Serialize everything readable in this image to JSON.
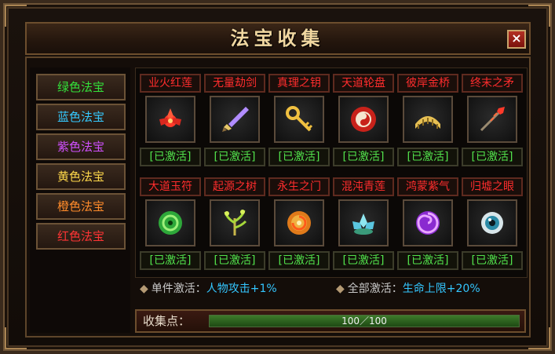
{
  "window": {
    "title": "法宝收集",
    "close_label": "×"
  },
  "sidebar": {
    "items": [
      {
        "label": "绿色法宝",
        "color": "#33e13a"
      },
      {
        "label": "蓝色法宝",
        "color": "#35c9ff"
      },
      {
        "label": "紫色法宝",
        "color": "#d050ff"
      },
      {
        "label": "黄色法宝",
        "color": "#ffd84a"
      },
      {
        "label": "橙色法宝",
        "color": "#ff8b2a"
      },
      {
        "label": "红色法宝",
        "color": "#ff3434"
      }
    ]
  },
  "treasures": {
    "row1": [
      {
        "name": "业火红莲",
        "status": "[已激活]",
        "icon": "red-lotus-icon"
      },
      {
        "name": "无量劫剑",
        "status": "[已激活]",
        "icon": "sword-icon"
      },
      {
        "name": "真理之钥",
        "status": "[已激活]",
        "icon": "key-icon"
      },
      {
        "name": "天道轮盘",
        "status": "[已激活]",
        "icon": "wheel-icon"
      },
      {
        "name": "彼岸金桥",
        "status": "[已激活]",
        "icon": "golden-bridge-icon"
      },
      {
        "name": "终末之矛",
        "status": "[已激活]",
        "icon": "spear-icon"
      }
    ],
    "row2": [
      {
        "name": "大道玉符",
        "status": "[已激活]",
        "icon": "jade-talisman-icon"
      },
      {
        "name": "起源之树",
        "status": "[已激活]",
        "icon": "tree-icon"
      },
      {
        "name": "永生之门",
        "status": "[已激活]",
        "icon": "portal-icon"
      },
      {
        "name": "混沌青莲",
        "status": "[已激活]",
        "icon": "blue-lotus-icon"
      },
      {
        "name": "鸿蒙紫气",
        "status": "[已激活]",
        "icon": "purple-vortex-icon"
      },
      {
        "name": "归墟之眼",
        "status": "[已激活]",
        "icon": "eye-icon"
      }
    ]
  },
  "bonuses": {
    "single_label": "单件激活：",
    "single_value": "人物攻击+1%",
    "all_label": "全部激活：",
    "all_value": "生命上限+20%"
  },
  "progress": {
    "label": "收集点：",
    "text": "100／100",
    "fraction": 1.0
  }
}
